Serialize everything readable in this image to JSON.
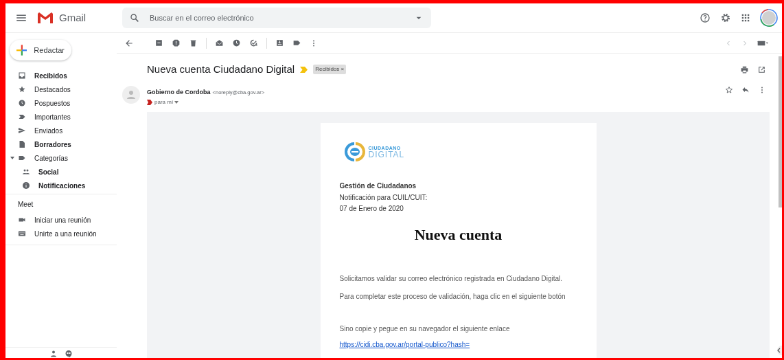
{
  "app": {
    "name": "Gmail"
  },
  "search": {
    "placeholder": "Buscar en el correo electrónico"
  },
  "compose": {
    "label": "Redactar"
  },
  "sidebar": {
    "items": [
      {
        "label": "Recibidos",
        "unread": true
      },
      {
        "label": "Destacados",
        "unread": false
      },
      {
        "label": "Pospuestos",
        "unread": false
      },
      {
        "label": "Importantes",
        "unread": false
      },
      {
        "label": "Enviados",
        "unread": false
      },
      {
        "label": "Borradores",
        "unread": true
      },
      {
        "label": "Categorías",
        "unread": false,
        "expanded": true,
        "children": [
          {
            "label": "Social",
            "unread": true
          },
          {
            "label": "Notificaciones",
            "unread": true
          }
        ]
      }
    ]
  },
  "meet": {
    "title": "Meet",
    "items": [
      {
        "label": "Iniciar una reunión"
      },
      {
        "label": "Unirte a una reunión"
      }
    ]
  },
  "message": {
    "subject": "Nueva cuenta Ciudadano Digital",
    "important": true,
    "labels": [
      {
        "text": "Recibidos",
        "remove": "×"
      }
    ],
    "sender_name": "Gobierno de Cordoba",
    "sender_email": "<noreply@cba.gov.ar>",
    "recipient": "para mí"
  },
  "email": {
    "logo_top": "CIUDADANO",
    "logo_bottom": "DIGITAL",
    "lines": [
      {
        "kind": "heading",
        "text": "Gestión de Ciudadanos"
      },
      {
        "kind": "line",
        "text": "Notificación para CUIL/CUIT:"
      },
      {
        "kind": "line",
        "text": "07 de Enero de 2020"
      }
    ],
    "title": "Nueva cuenta",
    "paragraphs": [
      "Solicitamos validar su correo electrónico registrada en Ciudadano Digital.",
      "Para completar este proceso de validación, haga clic en el siguiente botón"
    ],
    "link_intro": "Sino copie y pegue en su navegador el siguiente enlace",
    "link": "https://cidi.cba.gov.ar/portal-publico?hash="
  }
}
